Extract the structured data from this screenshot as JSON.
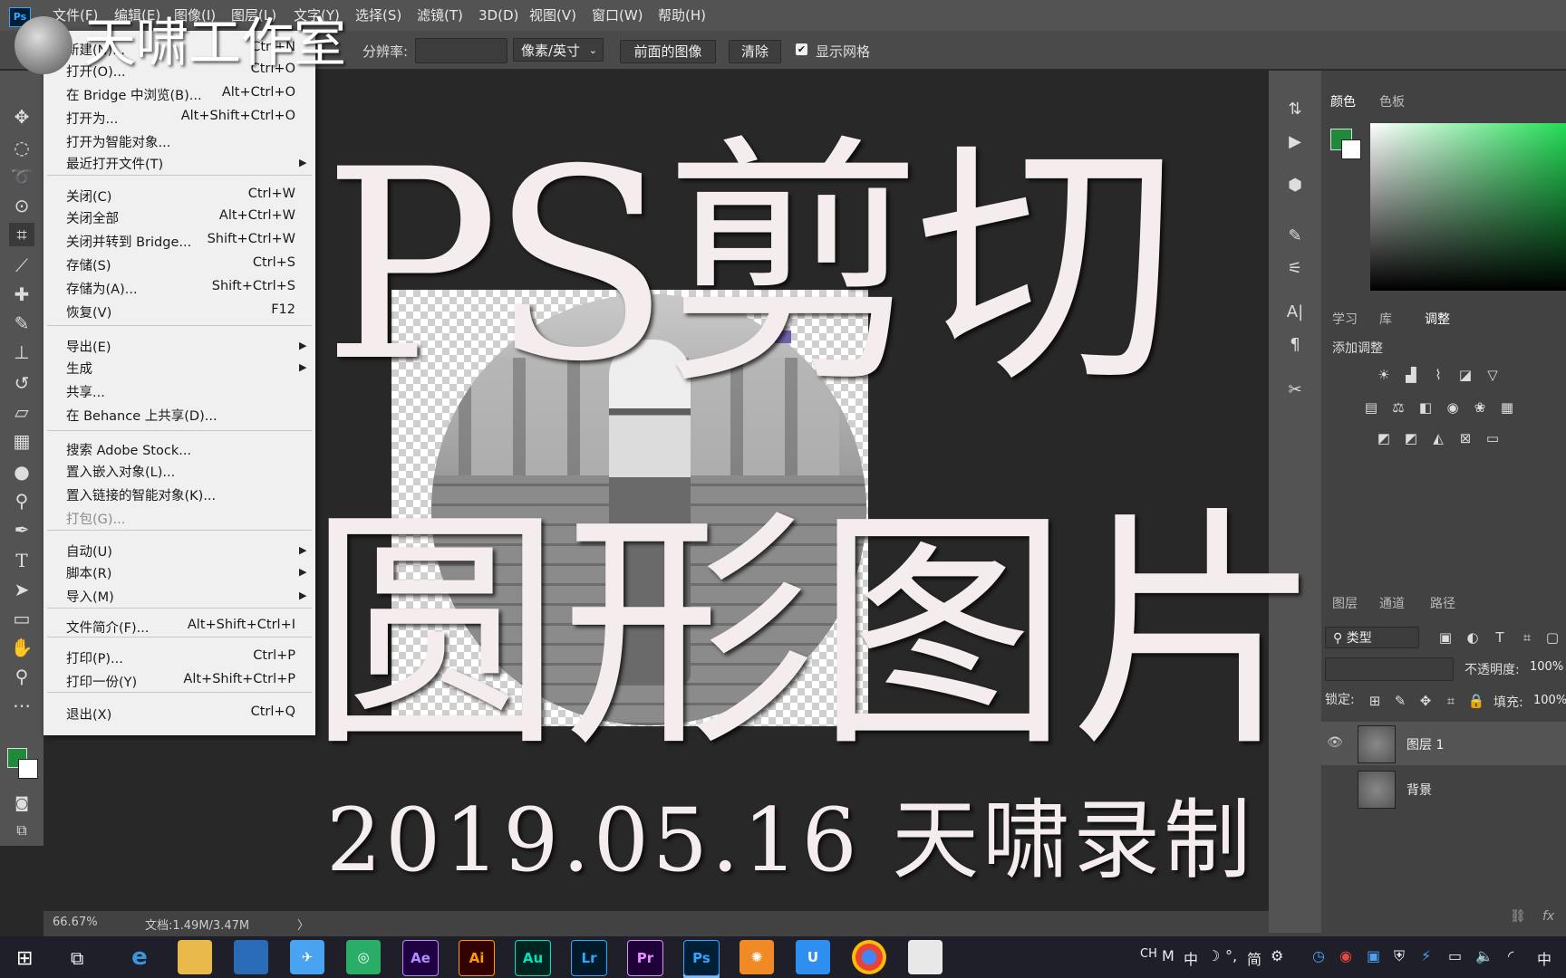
{
  "menubar": {
    "items": [
      "文件(F)",
      "编辑(E)",
      "图像(I)",
      "图层(L)",
      "文字(Y)",
      "选择(S)",
      "滤镜(T)",
      "3D(D)",
      "视图(V)",
      "窗口(W)",
      "帮助(H)"
    ]
  },
  "options": {
    "resolution_label": "分辨率:",
    "resolution_value": "",
    "unit_select": "像素/英寸",
    "front_image": "前面的图像",
    "clear": "清除",
    "show_grid": "显示网格"
  },
  "file_menu": {
    "items": [
      {
        "label": "新建(N)...",
        "shortcut": "Ctrl+N"
      },
      {
        "label": "打开(O)...",
        "shortcut": "Ctrl+O"
      },
      {
        "label": "在 Bridge 中浏览(B)...",
        "shortcut": "Alt+Ctrl+O"
      },
      {
        "label": "打开为...",
        "shortcut": "Alt+Shift+Ctrl+O"
      },
      {
        "label": "打开为智能对象...",
        "shortcut": ""
      },
      {
        "label": "最近打开文件(T)",
        "shortcut": ""
      },
      {
        "label": "关闭(C)",
        "shortcut": "Ctrl+W"
      },
      {
        "label": "关闭全部",
        "shortcut": "Alt+Ctrl+W"
      },
      {
        "label": "关闭并转到 Bridge...",
        "shortcut": "Shift+Ctrl+W"
      },
      {
        "label": "存储(S)",
        "shortcut": "Ctrl+S"
      },
      {
        "label": "存储为(A)...",
        "shortcut": "Shift+Ctrl+S"
      },
      {
        "label": "恢复(V)",
        "shortcut": "F12"
      },
      {
        "label": "导出(E)",
        "shortcut": ""
      },
      {
        "label": "生成",
        "shortcut": ""
      },
      {
        "label": "共享...",
        "shortcut": ""
      },
      {
        "label": "在 Behance 上共享(D)...",
        "shortcut": ""
      },
      {
        "label": "搜索 Adobe Stock...",
        "shortcut": ""
      },
      {
        "label": "置入嵌入对象(L)...",
        "shortcut": ""
      },
      {
        "label": "置入链接的智能对象(K)...",
        "shortcut": ""
      },
      {
        "label": "打包(G)...",
        "shortcut": ""
      },
      {
        "label": "自动(U)",
        "shortcut": ""
      },
      {
        "label": "脚本(R)",
        "shortcut": ""
      },
      {
        "label": "导入(M)",
        "shortcut": ""
      },
      {
        "label": "文件简介(F)...",
        "shortcut": "Alt+Shift+Ctrl+I"
      },
      {
        "label": "打印(P)...",
        "shortcut": "Ctrl+P"
      },
      {
        "label": "打印一份(Y)",
        "shortcut": "Alt+Shift+Ctrl+P"
      },
      {
        "label": "退出(X)",
        "shortcut": "Ctrl+Q"
      }
    ]
  },
  "overlay": {
    "line1": "PS剪切",
    "line2": "圆形图片",
    "line3": "2019.05.16 天啸录制",
    "watermark": "天啸工作室"
  },
  "status": {
    "zoom": "66.67%",
    "doc": "文档:1.49M/3.47M"
  },
  "panels": {
    "color_tabs": [
      "颜色",
      "色板"
    ],
    "adjust_tabs": [
      "学习",
      "库",
      "调整"
    ],
    "add_adjustment": "添加调整",
    "layer_tabs": [
      "图层",
      "通道",
      "路径"
    ],
    "filter_kind": "类型",
    "opacity_label": "不透明度:",
    "opacity_value": "100%",
    "lock_label": "锁定:",
    "fill_label": "填充:",
    "fill_value": "100%",
    "layers": [
      {
        "name": "图层 1"
      },
      {
        "name": "背景"
      }
    ]
  },
  "taskbar": {
    "apps": [
      "Ae",
      "Ai",
      "Au",
      "Lr",
      "Pr",
      "Ps"
    ],
    "tray": {
      "lang": "CH",
      "ime": "中",
      "simplified": "简",
      "right_ime": "中"
    }
  },
  "colors": {
    "fg": "#1f8a3a",
    "bg": "#ffffff"
  }
}
